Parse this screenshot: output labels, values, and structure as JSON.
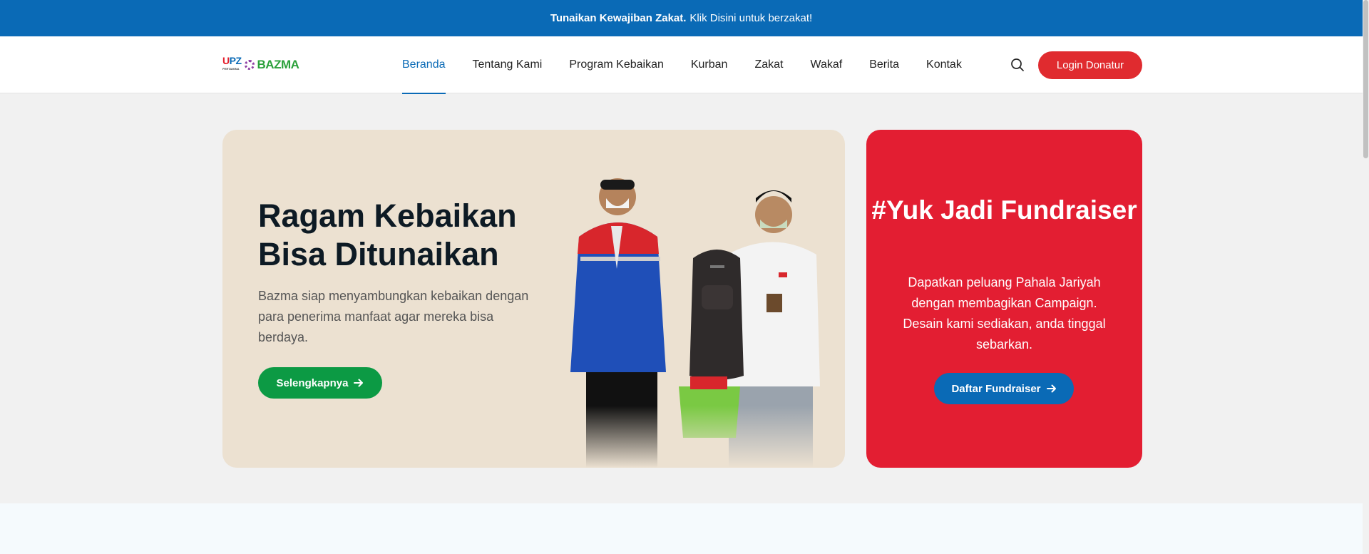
{
  "announcement": {
    "bold": "Tunaikan Kewajiban Zakat.",
    "text": "Klik Disini untuk berzakat!"
  },
  "logo": {
    "upz_u": "U",
    "upz_p": "P",
    "upz_z": "Z",
    "upz_sub": "PERTAMINA",
    "bazma": "BAZMA"
  },
  "nav": {
    "items": [
      {
        "label": "Beranda",
        "active": true
      },
      {
        "label": "Tentang Kami"
      },
      {
        "label": "Program Kebaikan"
      },
      {
        "label": "Kurban"
      },
      {
        "label": "Zakat"
      },
      {
        "label": "Wakaf"
      },
      {
        "label": "Berita"
      },
      {
        "label": "Kontak"
      }
    ],
    "search_icon": "search-icon",
    "login_label": "Login Donatur"
  },
  "hero": {
    "title": "Ragam Kebaikan Bisa Ditunaikan",
    "description": "Bazma siap menyambungkan kebaikan dengan para penerima manfaat agar mereka bisa berdaya.",
    "button_label": "Selengkapnya",
    "button_icon": "arrow-right-icon"
  },
  "fundraiser": {
    "title": "#Yuk Jadi Fundraiser",
    "description": "Dapatkan peluang Pahala Jariyah dengan membagikan Campaign. Desain kami sediakan, anda tinggal sebarkan.",
    "button_label": "Daftar Fundraiser",
    "button_icon": "arrow-right-icon"
  },
  "colors": {
    "primary_blue": "#0a6ab6",
    "brand_red": "#e31e32",
    "green": "#0c9a44",
    "hero_bg": "#ece1d1"
  }
}
